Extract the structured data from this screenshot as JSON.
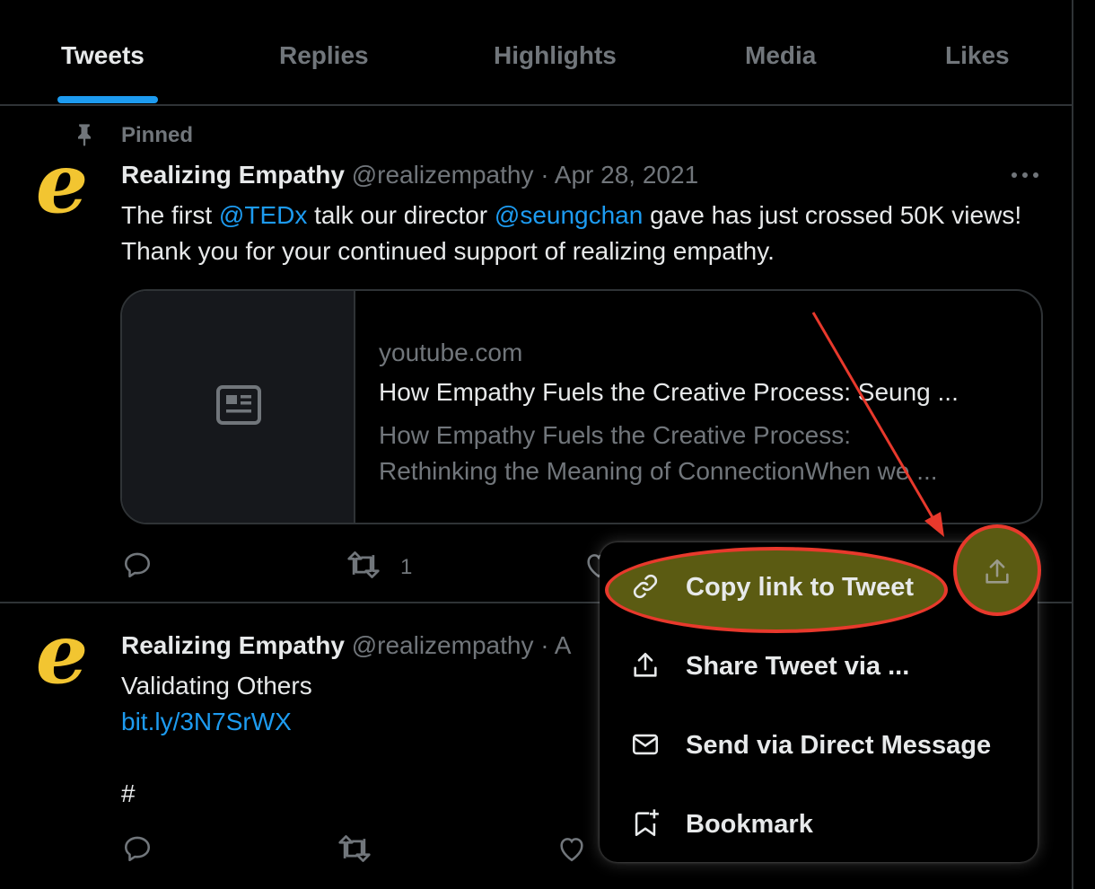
{
  "tabs": [
    {
      "label": "Tweets",
      "active": true
    },
    {
      "label": "Replies",
      "active": false
    },
    {
      "label": "Highlights",
      "active": false
    },
    {
      "label": "Media",
      "active": false
    },
    {
      "label": "Likes",
      "active": false
    }
  ],
  "accent_color": "#1d9bf0",
  "highlight_color": "#e8392c",
  "tweets": [
    {
      "pinned_label": "Pinned",
      "display_name": "Realizing Empathy",
      "handle": "@realizempathy",
      "separator": "·",
      "date": "Apr 28, 2021",
      "text": {
        "part1": "The first ",
        "mention1": "@TEDx",
        "part2": " talk our director ",
        "mention2": "@seungchan",
        "part3": " gave has just crossed 50K views! Thank you for your continued support of realizing empathy."
      },
      "card": {
        "domain": "youtube.com",
        "title": "How Empathy Fuels the Creative Process: Seung ...",
        "description_line1": "How Empathy Fuels the Creative Process:",
        "description_line2": "Rethinking the Meaning of ConnectionWhen we ..."
      },
      "retweet_count": "1"
    },
    {
      "display_name": "Realizing Empathy",
      "handle": "@realizempathy",
      "separator": "·",
      "date_partial": "A",
      "line1": "Validating Others",
      "link": "bit.ly/3N7SrWX",
      "line3": "#"
    }
  ],
  "share_menu": {
    "items": [
      {
        "label": "Copy link to Tweet",
        "icon": "link-icon",
        "highlighted": true
      },
      {
        "label": "Share Tweet via ...",
        "icon": "share-icon"
      },
      {
        "label": "Send via Direct Message",
        "icon": "envelope-icon"
      },
      {
        "label": "Bookmark",
        "icon": "bookmark-add-icon"
      }
    ]
  }
}
